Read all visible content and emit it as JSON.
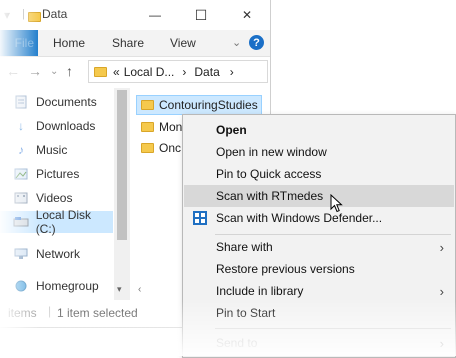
{
  "window": {
    "title": "Data",
    "controls": {
      "minimize": "—",
      "maximize": "☐",
      "close": "✕"
    }
  },
  "ribbon": {
    "file_tab": "File",
    "tabs": [
      "Home",
      "Share",
      "View"
    ],
    "help": "?"
  },
  "address": {
    "prefix": "«",
    "crumbs": [
      "Local D...",
      "Data"
    ],
    "separator": "›"
  },
  "nav": {
    "items": [
      {
        "label": "Documents",
        "icon": "documents-icon"
      },
      {
        "label": "Downloads",
        "icon": "downloads-icon"
      },
      {
        "label": "Music",
        "icon": "music-icon"
      },
      {
        "label": "Pictures",
        "icon": "pictures-icon"
      },
      {
        "label": "Videos",
        "icon": "videos-icon"
      },
      {
        "label": "Local Disk (C:)",
        "icon": "disk-icon",
        "selected": true
      },
      {
        "label": "Network",
        "icon": "network-icon"
      },
      {
        "label": "Homegroup",
        "icon": "homegroup-icon"
      }
    ]
  },
  "files": [
    {
      "name": "ContouringStudies",
      "selected": true
    },
    {
      "name": "Mon"
    },
    {
      "name": "Onc"
    }
  ],
  "status": {
    "count": "items",
    "selection": "1 item selected"
  },
  "menu": {
    "items": [
      {
        "label": "Open",
        "bold": true
      },
      {
        "label": "Open in new window"
      },
      {
        "label": "Pin to Quick access"
      },
      {
        "label": "Scan with RTmedes",
        "hover": true
      },
      {
        "label": "Scan with Windows Defender...",
        "icon": "windows-defender-icon"
      },
      {
        "label": "Share with",
        "submenu": true
      },
      {
        "label": "Restore previous versions"
      },
      {
        "label": "Include in library",
        "submenu": true
      },
      {
        "label": "Pin to Start"
      },
      {
        "label": "Send to",
        "submenu": true,
        "faded": true
      }
    ]
  },
  "colors": {
    "accent": "#1979ca",
    "selection": "#cce8ff",
    "menu_bg": "#f2f2f2",
    "menu_hover": "#d8d8d8",
    "folder": "#f5c94d"
  }
}
